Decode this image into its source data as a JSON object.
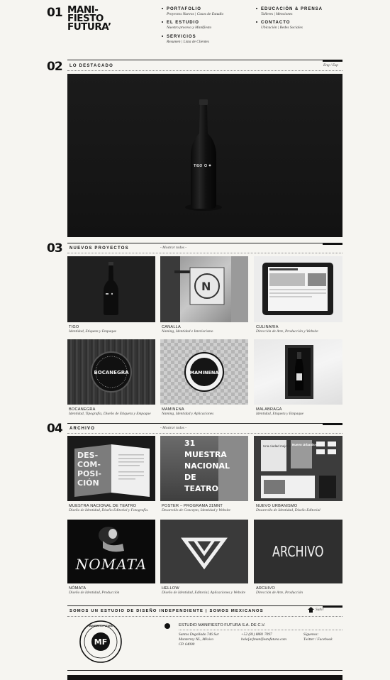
{
  "header": {
    "number": "01",
    "logo_lines": [
      "MANI-",
      "FIESTO",
      "FUTURA’"
    ],
    "nav": [
      {
        "label": "PORTAFOLIO",
        "sub": "Proyectos Nuevos | Casos de Estudio"
      },
      {
        "label": "EL ESTUDIO",
        "sub": "Nuestro proceso y Manifiesto"
      },
      {
        "label": "SERVICIOS",
        "sub": "Resumen | Lista de Clientes"
      },
      {
        "label": "EDUCACIÓN & PRENSA",
        "sub": "Talleres | Menciones"
      },
      {
        "label": "CONTACTO",
        "sub": "Ubicación | Redes Sociales"
      }
    ]
  },
  "featured": {
    "number": "02",
    "title": "LO DESTACADO",
    "lang": "Eng / Esp",
    "bottle_text": "TIGO"
  },
  "new_projects": {
    "number": "03",
    "title": "NUEVOS PROYECTOS",
    "show_all": "- Mostrar todos -",
    "items": [
      {
        "title": "TIGO",
        "desc": "Identidad, Etiqueta y Empaque"
      },
      {
        "title": "CANALLA",
        "desc": "Naming, Identidad e Interiorismo"
      },
      {
        "title": "CULINARIA",
        "desc": "Dirección de Arte, Producción y Website"
      },
      {
        "title": "BOCANEGRA",
        "desc": "Identidad, Tipografía, Diseño de Etiqueta y Empaque"
      },
      {
        "title": "MAMINENA",
        "desc": "Naming, Identidad y Aplicaciones"
      },
      {
        "title": "MALABRAGA",
        "desc": "Identidad, Etiqueta y Empaque"
      }
    ],
    "tile_texts": {
      "bocanegra": "BOCANEGRA",
      "maminena": "MAMINENA"
    }
  },
  "archive": {
    "number": "04",
    "title": "ARCHIVO",
    "show_all": "- Mostrar todos -",
    "items": [
      {
        "title": "MUESTRA NACIONAL DE TEATRO",
        "desc": "Diseño de Identidad, Diseño Editorial y Fotografía."
      },
      {
        "title": "POSTER – PROGRAMA 31MNT",
        "desc": "Desarrollo de Concepto, Identidad y Website"
      },
      {
        "title": "NUEVO URBANISMO",
        "desc": "Desarrollo de Identidad, Diseño Editorial"
      },
      {
        "title": "NÓMATA",
        "desc": "Diseño de Identidad, Producción"
      },
      {
        "title": "HELLOW",
        "desc": "Diseño de Identidad, Editorial, Aplicaciones y Website"
      },
      {
        "title": "ARCHIVO",
        "desc": "Dirección de Arte, Producción"
      }
    ],
    "tile_texts": {
      "decomposicion": [
        "DES-",
        "COM-",
        "POSI-",
        "CIÓN"
      ],
      "teatro": [
        "31",
        "MUESTRA",
        "NACIONAL",
        "DE",
        "TEATRO"
      ],
      "urbanismo_a": "Una ciudad mejor es posible.",
      "urbanismo_b": "Nuevo Urbanis-mo",
      "nomata": "NOMATA",
      "archivo": "ARCHIVO"
    }
  },
  "footer": {
    "banner": "SOMOS UN ESTUDIO DE DISEÑO INDEPENDIENTE | SOMOS MEXICANOS",
    "top_link": "Subir",
    "company": "ESTUDIO MANIFIESTO FUTURA S.A. DE C.V.",
    "address": [
      "Santos Degollado 746 Sur",
      "Monterrey NL, México",
      "CP. 64000"
    ],
    "phone": "+52 (81) 8881 7097",
    "email": "hola[at]manifiestofutura.com",
    "follow": "Síguenos:",
    "social": "Twitter / Facebook",
    "seal_text": "MANIFIESTO FUTURA"
  },
  "colors": {
    "background": "#f6f5f1",
    "ink": "#111111"
  }
}
